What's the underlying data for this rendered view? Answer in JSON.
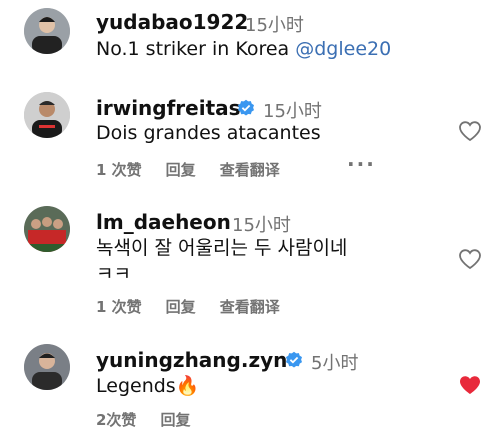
{
  "comments": [
    {
      "username": "yudabao1922",
      "time": "15小时",
      "text": "No.1 striker in Korea ",
      "mention": "@dglee20",
      "verified": false
    },
    {
      "username": "irwingfreitas",
      "time": "15小时",
      "text": "Dois grandes atacantes",
      "verified": true,
      "likes": "1 次赞",
      "reply": "回复",
      "translate": "查看翻译",
      "more": "···",
      "liked": false
    },
    {
      "username": "lm_daeheon",
      "time": "15小时",
      "text_line1": "녹색이 잘 어울리는 두 사람이네",
      "text_line2": "ㅋㅋ",
      "verified": false,
      "likes": "1 次赞",
      "reply": "回复",
      "translate": "查看翻译",
      "liked": false
    },
    {
      "username": "yuningzhang.zyn",
      "time": "5小时",
      "text": "Legends",
      "emoji": "🔥",
      "verified": true,
      "likes": "2次赞",
      "reply": "回复",
      "liked": true
    }
  ],
  "colors": {
    "heart_liked": "#e8293b",
    "mention": "#3b6fb3",
    "verified": "#3a97f0",
    "muted": "#737373"
  }
}
